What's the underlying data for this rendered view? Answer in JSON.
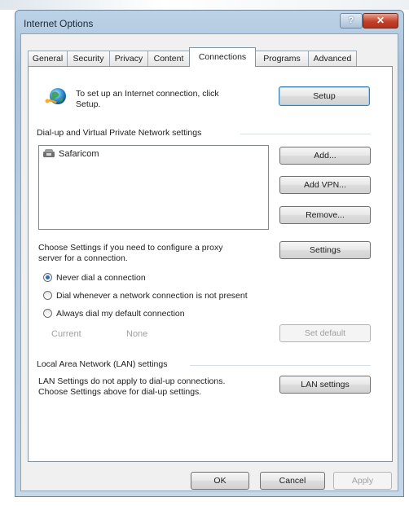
{
  "window": {
    "title": "Internet Options",
    "help_label": "?",
    "close_label": "✕"
  },
  "tabs": [
    {
      "label": "General",
      "active": false
    },
    {
      "label": "Security",
      "active": false
    },
    {
      "label": "Privacy",
      "active": false
    },
    {
      "label": "Content",
      "active": false
    },
    {
      "label": "Connections",
      "active": true
    },
    {
      "label": "Programs",
      "active": false
    },
    {
      "label": "Advanced",
      "active": false
    }
  ],
  "setup": {
    "text_line1": "To set up an Internet connection, click",
    "text_line2": "Setup.",
    "button_label": "Setup",
    "icon": "globe-network-icon"
  },
  "dialup": {
    "group_label": "Dial-up and Virtual Private Network settings",
    "connections": [
      {
        "name": "Safaricom",
        "icon": "phone-connection-icon"
      }
    ],
    "add_label": "Add...",
    "add_vpn_label": "Add VPN...",
    "remove_label": "Remove...",
    "settings_text_line1": "Choose Settings if you need to configure a proxy",
    "settings_text_line2": "server for a connection.",
    "settings_label": "Settings",
    "radios": [
      {
        "label": "Never dial a connection",
        "checked": true
      },
      {
        "label": "Dial whenever a network connection is not present",
        "checked": false
      },
      {
        "label": "Always dial my default connection",
        "checked": false
      }
    ],
    "current_label": "Current",
    "current_value": "None",
    "set_default_label": "Set default"
  },
  "lan": {
    "group_label": "Local Area Network (LAN) settings",
    "text_line1": "LAN Settings do not apply to dial-up connections.",
    "text_line2": "Choose Settings above for dial-up settings.",
    "button_label": "LAN settings"
  },
  "footer": {
    "ok_label": "OK",
    "cancel_label": "Cancel",
    "apply_label": "Apply"
  },
  "colors": {
    "accent_focus": "#3c7fb1",
    "radio_dot": "#2f6fb5",
    "close_red": "#c3402a"
  }
}
